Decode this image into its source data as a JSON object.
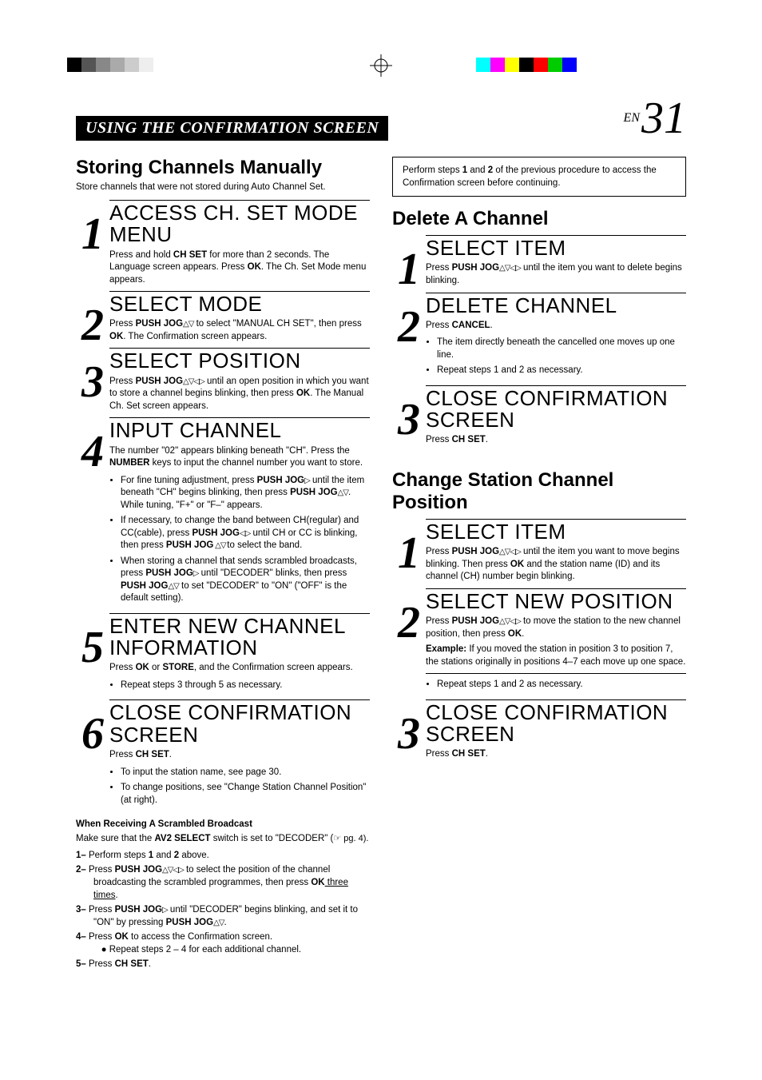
{
  "header": {
    "title": "USING THE CONFIRMATION SCREEN",
    "page_label": "EN",
    "page_number": "31"
  },
  "left": {
    "title": "Storing Channels Manually",
    "subtitle": "Store channels that were not stored during Auto Channel Set.",
    "steps": [
      {
        "num": "1",
        "head": "ACCESS CH. SET MODE MENU",
        "text_pre": "Press and hold ",
        "b1": "CH SET",
        "text_mid": " for more than 2 seconds. The Language screen appears. Press ",
        "b2": "OK",
        "text_post": ". The Ch. Set Mode menu appears."
      },
      {
        "num": "2",
        "head": "SELECT MODE",
        "text_pre": "Press ",
        "b1": "PUSH JOG",
        "arrows1": "△▽",
        "text_mid": " to select \"MANUAL CH SET\", then press ",
        "b2": "OK",
        "text_post": ". The Confirmation screen appears."
      },
      {
        "num": "3",
        "head": "SELECT POSITION",
        "text_pre": "Press ",
        "b1": "PUSH JOG",
        "arrows1": "△▽◁▷",
        "text_mid": " until an open position in which you want to store a channel begins blinking, then press ",
        "b2": "OK",
        "text_post": ". The Manual Ch. Set screen appears."
      },
      {
        "num": "4",
        "head": "INPUT CHANNEL",
        "text_pre": "The number \"02\" appears blinking beneath \"CH\". Press the ",
        "b1": "NUMBER",
        "text_post": " keys to input the channel number you want to store.",
        "bullets": [
          {
            "pre": "For fine tuning adjustment, press ",
            "b": "PUSH JOG",
            "arr": "▷",
            "mid": " until the item beneath \"CH\" begins blinking, then press ",
            "b2": "PUSH JOG",
            "arr2": "△▽",
            "post": ". While tuning, \"F+\" or \"F–\" appears."
          },
          {
            "pre": "If necessary, to change the band between CH(regular) and CC(cable), press ",
            "b": "PUSH JOG",
            "arr": "◁▷",
            "mid": " until CH or CC is blinking, then press ",
            "b2": "PUSH JOG",
            "arr2": " △▽ ",
            "post": " to select the band."
          },
          {
            "pre": "When storing a channel that sends scrambled broadcasts, press ",
            "b": "PUSH JOG",
            "arr": "▷",
            "mid": " until \"DECODER\" blinks, then press ",
            "b2": "PUSH JOG",
            "arr2": "△▽",
            "post": " to set \"DECODER\" to \"ON\" (\"OFF\" is the default setting)."
          }
        ]
      },
      {
        "num": "5",
        "head": "ENTER NEW CHANNEL INFORMATION",
        "text_pre": "Press ",
        "b1": "OK",
        "text_mid": " or ",
        "b2": "STORE",
        "text_post": ", and the Confirmation screen appears.",
        "bullets_simple": [
          "Repeat steps 3 through 5 as necessary."
        ]
      },
      {
        "num": "6",
        "head": "CLOSE CONFIRMATION SCREEN",
        "text_pre": "Press ",
        "b1": "CH SET",
        "text_post": ".",
        "bullets_simple": [
          "To input the station name, see page 30.",
          "To change positions, see \"Change Station Channel Position\" (at right)."
        ]
      }
    ],
    "scrambled": {
      "title": "When Receiving A Scrambled Broadcast",
      "intro_pre": "Make sure that the ",
      "intro_b": "AV2 SELECT",
      "intro_post": " switch is set to \"DECODER\" (",
      "pg_ref": "☞ pg. 4).",
      "items": [
        {
          "lbl": "1–",
          "pre": " Perform steps ",
          "b": "1",
          "mid": " and ",
          "b2": "2",
          "post": " above."
        },
        {
          "lbl": "2–",
          "pre": " Press ",
          "b": "PUSH JOG",
          "arr": "△▽◁▷",
          "mid": " to select the position of the channel broadcasting the scrambled programmes, then press ",
          "b2": "OK",
          "post_u": " three times",
          "post": "."
        },
        {
          "lbl": "3–",
          "pre": " Press ",
          "b": "PUSH JOG",
          "arr": "▷",
          "mid": " until \"DECODER\" begins blinking, and set it to \"ON\" by pressing ",
          "b2": "PUSH JOG",
          "arr2": "△▽",
          "post": "."
        },
        {
          "lbl": "4–",
          "pre": " Press ",
          "b": "OK",
          "post": " to access the Confirmation screen.",
          "sub": "● Repeat steps 2 – 4 for each additional channel."
        },
        {
          "lbl": "5–",
          "pre": " Press ",
          "b": "CH SET",
          "post": "."
        }
      ]
    }
  },
  "right": {
    "note_pre": "Perform steps ",
    "note_b1": "1",
    "note_mid": " and ",
    "note_b2": "2",
    "note_post": " of the previous procedure to access the Confirmation screen before continuing.",
    "delete": {
      "title": "Delete A Channel",
      "steps": [
        {
          "num": "1",
          "head": "SELECT ITEM",
          "text_pre": "Press ",
          "b1": "PUSH JOG",
          "arrows1": "△▽◁▷",
          "text_post": " until the item you want to delete begins blinking."
        },
        {
          "num": "2",
          "head": "DELETE CHANNEL",
          "text_pre": "Press ",
          "b1": "CANCEL",
          "text_post": ".",
          "bullets_simple": [
            "The item directly beneath the cancelled one moves up one line.",
            "Repeat steps 1 and 2 as necessary."
          ]
        },
        {
          "num": "3",
          "head": "CLOSE CONFIRMATION SCREEN",
          "text_pre": "Press ",
          "b1": "CH SET",
          "text_post": "."
        }
      ]
    },
    "change": {
      "title": "Change Station Channel Position",
      "steps": [
        {
          "num": "1",
          "head": "SELECT ITEM",
          "text_pre": "Press ",
          "b1": "PUSH JOG",
          "arrows1": "△▽◁▷",
          "text_mid": " until the item you want to move begins blinking. Then press ",
          "b2": "OK",
          "text_post": " and the station name (ID) and its channel (CH) number begin blinking."
        },
        {
          "num": "2",
          "head": "SELECT NEW POSITION",
          "text_pre": "Press ",
          "b1": "PUSH JOG",
          "arrows1": "△▽◁▷",
          "text_mid": " to move the station to the new channel position, then press ",
          "b2": "OK",
          "text_post": ".",
          "example_label": "Example:",
          "example": "  If you moved the station in position 3 to position 7, the stations originally in positions 4–7 each move up one space.",
          "bullets_simple": [
            "Repeat steps 1 and 2 as necessary."
          ]
        },
        {
          "num": "3",
          "head": "CLOSE CONFIRMATION SCREEN",
          "text_pre": "Press ",
          "b1": "CH SET",
          "text_post": "."
        }
      ]
    }
  }
}
